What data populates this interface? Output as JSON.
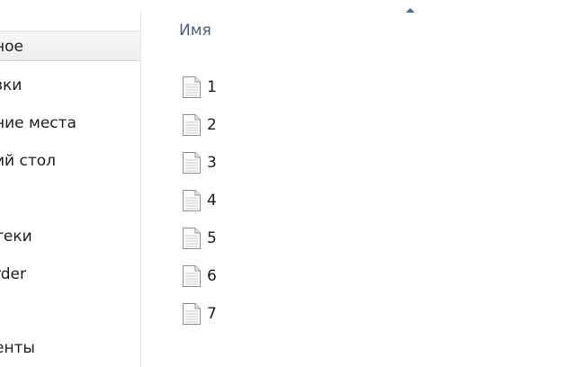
{
  "nav": {
    "items": [
      {
        "label": "ное",
        "selected": true
      },
      {
        "label": "зки",
        "selected": false
      },
      {
        "label": "ние места",
        "selected": false
      },
      {
        "label": "ий стол",
        "selected": false
      },
      {
        "label": "",
        "selected": false
      },
      {
        "label": "теки",
        "selected": false
      },
      {
        "label": "rder",
        "selected": false
      },
      {
        "label": "",
        "selected": false
      },
      {
        "label": "енты",
        "selected": false
      }
    ]
  },
  "content": {
    "column_header": "Имя",
    "sort_icon": "sort-ascending-icon",
    "files": [
      {
        "name": "1",
        "icon": "text-file-icon"
      },
      {
        "name": "2",
        "icon": "text-file-icon"
      },
      {
        "name": "3",
        "icon": "text-file-icon"
      },
      {
        "name": "4",
        "icon": "text-file-icon"
      },
      {
        "name": "5",
        "icon": "text-file-icon"
      },
      {
        "name": "6",
        "icon": "text-file-icon"
      },
      {
        "name": "7",
        "icon": "text-file-icon"
      }
    ]
  },
  "colors": {
    "header_text": "#4c607a",
    "sort_arrow": "#4d6c92",
    "text": "#1e1e1e",
    "selected_bg": "#ededee"
  }
}
